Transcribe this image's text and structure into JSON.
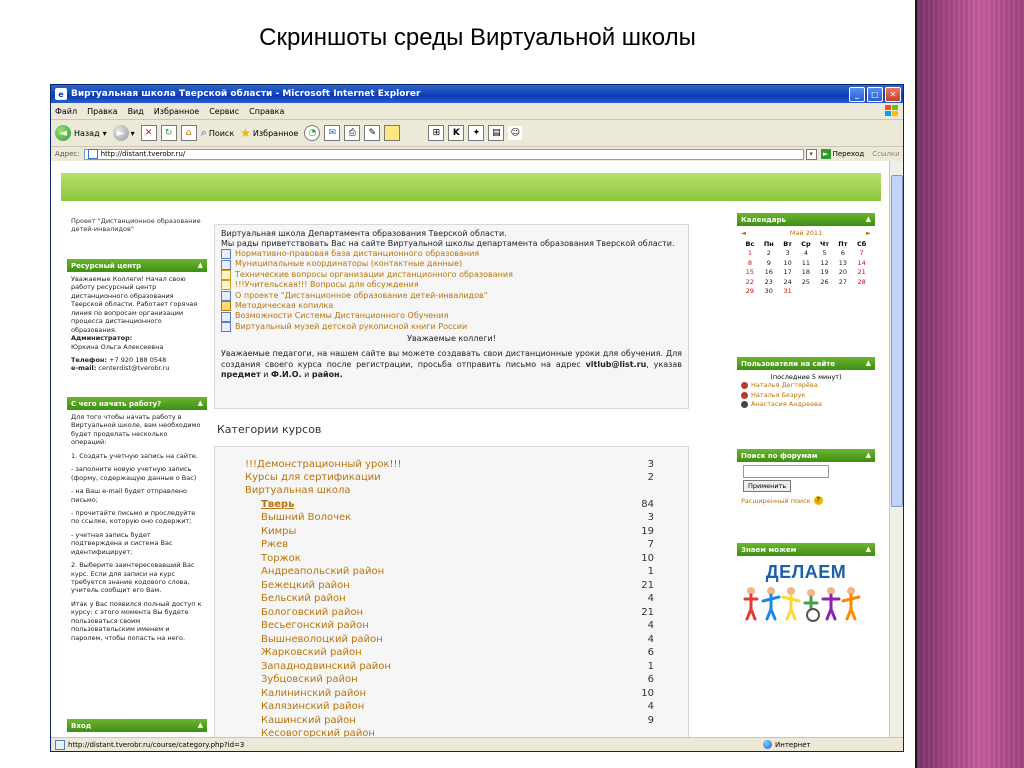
{
  "slide": {
    "title": "Скриншоты среды Виртуальной школы"
  },
  "window": {
    "title": "Виртуальная школа Тверской области - Microsoft Internet Explorer",
    "menu": [
      "Файл",
      "Правка",
      "Вид",
      "Избранное",
      "Сервис",
      "Справка"
    ],
    "toolbar": {
      "back": "Назад",
      "search": "Поиск",
      "favorites": "Избранное"
    },
    "address": {
      "label": "Адрес:",
      "url": "http://distant.tverobr.ru/",
      "go": "Переход",
      "links": "Ссылки"
    },
    "status": {
      "url": "http://distant.tverobr.ru/course/category.php?id=3",
      "zone": "Интернет"
    }
  },
  "page": {
    "project": "Проект \"Дистанционное образование детей-инвалидов\"",
    "resource_center": {
      "title": "Ресурсный центр",
      "text": "Уважаемые Коллеги! Начал свою работу ресурсный центр дистанционного образования Тверской области. Работает горячая линия по вопросам организации процесса дистанционного образования.",
      "admin_label": "Администратор:",
      "admin_name": "Юркина Ольга Алексеевна",
      "phone_label": "Телефон:",
      "phone": "+7 920 188 0548",
      "email_label": "e-mail:",
      "email": "centerdist@tverobr.ru"
    },
    "start": {
      "title": "С чего начать работу?",
      "paragraphs": [
        "Для того чтобы начать работу в Виртуальной школе, вам необходимо будет проделать несколько операций:",
        "1. Создать учетную запись на сайте.",
        "- заполните новую учетную запись (форму, содержащую данные о Вас)",
        "- на Ваш e-mail будет отправлено письмо;",
        "- прочитайте письмо и проследуйте по ссылке, которую оно содержит;",
        "- учетная запись будет подтверждена и система Вас идентифицирует;",
        "2. Выберите заинтересовавший Вас курс. Если для записи на курс требуется знание кодового слова, учитель сообщит его Вам.",
        "Итак у Вас появился полный доступ к курсу: с этого момента Вы будете пользоваться своим пользовательским именем и паролем, чтобы попасть на него."
      ]
    },
    "login_block": {
      "title": "Вход"
    },
    "intro": {
      "lines": [
        "Виртуальная школа Департамента образования Тверской области.",
        "Мы рады приветствовать Вас на сайте Виртуальной школы департамента образования Тверской области."
      ],
      "links": [
        "Нормативно-правовая база дистанционного образования",
        "Муниципальные координаторы (контактные данные)",
        "Технические вопросы организации дистанционного образования",
        "!!!Учительская!!! Вопросы для обсуждения",
        "О проекте \"Дистанционное образование детей-инвалидов\"",
        "Методическая копилка",
        "Возможности Системы Дистанционного Обучения",
        "Виртуальный музей детской рукописной книги России"
      ],
      "greeting": "Уважаемые коллеги!",
      "body_start": "Уважаемые педагоги, на нашем сайте вы можете создавать свои дистанционные уроки для обучения. Для создания своего курса после регистрации, просьба отправить письмо на адрес",
      "email": "vitlub@list.ru",
      "body_mid": ", указав",
      "subject": "предмет",
      "and": "и",
      "fio": "Ф.И.О.",
      "and2": "и",
      "district": "район."
    },
    "categories": {
      "title": "Категории курсов",
      "top": [
        {
          "name": "!!!Демонстрационный урок!!!",
          "count": "3"
        },
        {
          "name": "Курсы для сертификации",
          "count": "2"
        },
        {
          "name": "Виртуальная школа",
          "count": ""
        }
      ],
      "sub": [
        {
          "name": "Тверь",
          "count": "84"
        },
        {
          "name": "Вышний Волочек",
          "count": "3"
        },
        {
          "name": "Кимры",
          "count": "19"
        },
        {
          "name": "Ржев",
          "count": "7"
        },
        {
          "name": "Торжок",
          "count": "10"
        },
        {
          "name": "Андреапольский район",
          "count": "1"
        },
        {
          "name": "Бежецкий район",
          "count": "21"
        },
        {
          "name": "Бельский район",
          "count": "4"
        },
        {
          "name": "Бологовский район",
          "count": "21"
        },
        {
          "name": "Весьегонский район",
          "count": "4"
        },
        {
          "name": "Вышневолоцкий район",
          "count": "4"
        },
        {
          "name": "Жарковский район",
          "count": "6"
        },
        {
          "name": "Западнодвинский район",
          "count": "1"
        },
        {
          "name": "Зубцовский район",
          "count": "6"
        },
        {
          "name": "Калининский район",
          "count": "10"
        },
        {
          "name": "Калязинский район",
          "count": "4"
        },
        {
          "name": "Кашинский район",
          "count": "9"
        },
        {
          "name": "Кесовогорский район",
          "count": ""
        }
      ]
    },
    "calendar": {
      "title": "Календарь",
      "prev": "◄",
      "next": "►",
      "month": "Май 2011",
      "weekdays": [
        "Вс",
        "Пн",
        "Вт",
        "Ср",
        "Чт",
        "Пт",
        "Сб"
      ],
      "weeks": [
        [
          "1",
          "2",
          "3",
          "4",
          "5",
          "6",
          "7"
        ],
        [
          "8",
          "9",
          "10",
          "11",
          "12",
          "13",
          "14"
        ],
        [
          "15",
          "16",
          "17",
          "18",
          "19",
          "20",
          "21"
        ],
        [
          "22",
          "23",
          "24",
          "25",
          "26",
          "27",
          "28"
        ],
        [
          "29",
          "30",
          "31",
          "",
          "",
          "",
          ""
        ]
      ]
    },
    "users": {
      "title": "Пользователи на сайте",
      "subtitle": "(последние 5 минут)",
      "list": [
        "Наталья Дегтярёва",
        "Наталья Безрук",
        "Анастасия Андреева"
      ]
    },
    "forum_search": {
      "title": "Поиск по форумам",
      "button": "Применить",
      "advanced": "Расширенный поиск"
    },
    "znaem": {
      "title": "Знаем можем",
      "image_text": "ДЕЛАЕМ"
    }
  }
}
